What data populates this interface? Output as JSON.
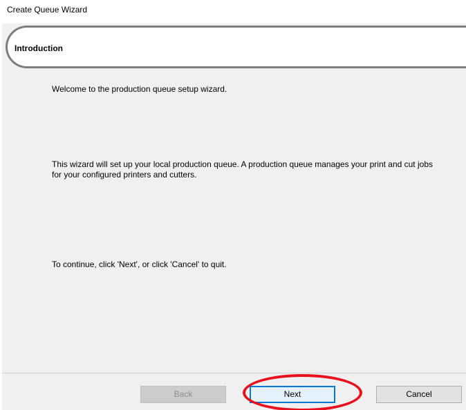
{
  "window": {
    "title": "Create Queue Wizard"
  },
  "header": {
    "title": "Introduction"
  },
  "content": {
    "welcome": "Welcome to the production queue setup wizard.",
    "description": "This wizard will set up your local production queue. A production queue manages your print and cut jobs for your configured printers and cutters.",
    "continue_hint": "To continue, click 'Next', or click 'Cancel' to quit."
  },
  "footer": {
    "back_label": "Back",
    "back_enabled": false,
    "next_label": "Next",
    "cancel_label": "Cancel"
  },
  "colors": {
    "panel_background": "#f0f0f0",
    "header_border": "#7d7d7d",
    "focus_border": "#0078d7",
    "annotation_highlight": "#e8101c"
  }
}
